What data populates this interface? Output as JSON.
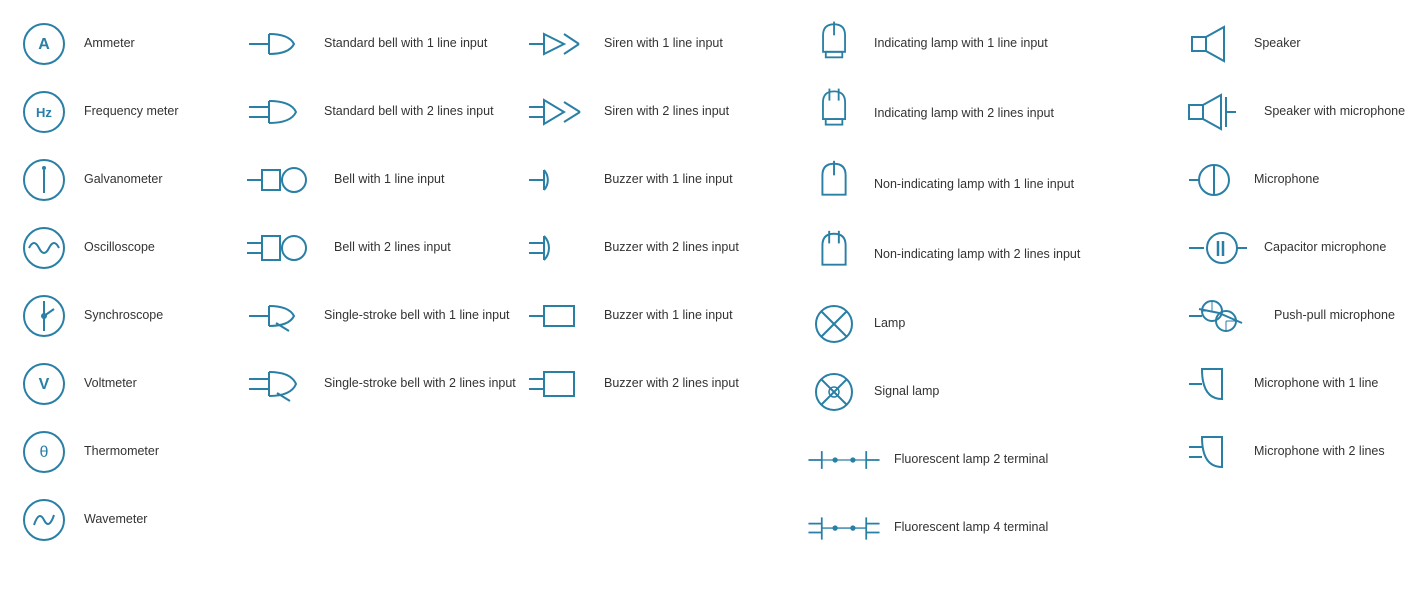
{
  "col1": {
    "items": [
      {
        "id": "ammeter",
        "label": "Ammeter"
      },
      {
        "id": "frequency-meter",
        "label": "Frequency meter"
      },
      {
        "id": "galvanometer",
        "label": "Galvanometer"
      },
      {
        "id": "oscilloscope",
        "label": "Oscilloscope"
      },
      {
        "id": "synchroscope",
        "label": "Synchroscope"
      },
      {
        "id": "voltmeter",
        "label": "Voltmeter"
      },
      {
        "id": "thermometer",
        "label": "Thermometer"
      },
      {
        "id": "wavemeter",
        "label": "Wavemeter"
      }
    ]
  },
  "col2": {
    "items": [
      {
        "id": "std-bell-1",
        "label": "Standard bell with 1 line input"
      },
      {
        "id": "std-bell-2",
        "label": "Standard bell with 2 lines input"
      },
      {
        "id": "bell-1",
        "label": "Bell with 1 line input"
      },
      {
        "id": "bell-2",
        "label": "Bell with 2 lines input"
      },
      {
        "id": "single-bell-1",
        "label": "Single-stroke bell with 1 line input"
      },
      {
        "id": "single-bell-2",
        "label": "Single-stroke bell with 2 lines input"
      }
    ]
  },
  "col3": {
    "items": [
      {
        "id": "siren-1",
        "label": "Siren with 1 line input"
      },
      {
        "id": "siren-2",
        "label": "Siren with 2 lines input"
      },
      {
        "id": "buzzer-1line",
        "label": "Buzzer with 1 line input"
      },
      {
        "id": "buzzer-2lines",
        "label": "Buzzer with 2 lines input"
      },
      {
        "id": "buzzer-box-1",
        "label": "Buzzer with 1 line input"
      },
      {
        "id": "buzzer-box-2",
        "label": "Buzzer with 2 lines input"
      }
    ]
  },
  "col4": {
    "items": [
      {
        "id": "ind-lamp-1",
        "label": "Indicating lamp with 1 line input"
      },
      {
        "id": "ind-lamp-2",
        "label": "Indicating lamp with 2 lines input"
      },
      {
        "id": "non-ind-lamp-1",
        "label": "Non-indicating lamp with 1 line input"
      },
      {
        "id": "non-ind-lamp-2",
        "label": "Non-indicating lamp with 2 lines input"
      },
      {
        "id": "lamp",
        "label": "Lamp"
      },
      {
        "id": "signal-lamp",
        "label": "Signal lamp"
      },
      {
        "id": "fluor-2",
        "label": "Fluorescent lamp 2 terminal"
      },
      {
        "id": "fluor-4",
        "label": "Fluorescent lamp 4 terminal"
      }
    ]
  },
  "col5": {
    "items": [
      {
        "id": "speaker",
        "label": "Speaker"
      },
      {
        "id": "speaker-mic",
        "label": "Speaker with microphone"
      },
      {
        "id": "microphone",
        "label": "Microphone"
      },
      {
        "id": "cap-microphone",
        "label": "Capacitor microphone"
      },
      {
        "id": "push-pull-mic",
        "label": "Push-pull microphone"
      },
      {
        "id": "mic-1line",
        "label": "Microphone with 1 line"
      },
      {
        "id": "mic-2lines",
        "label": "Microphone with 2 lines"
      }
    ]
  }
}
